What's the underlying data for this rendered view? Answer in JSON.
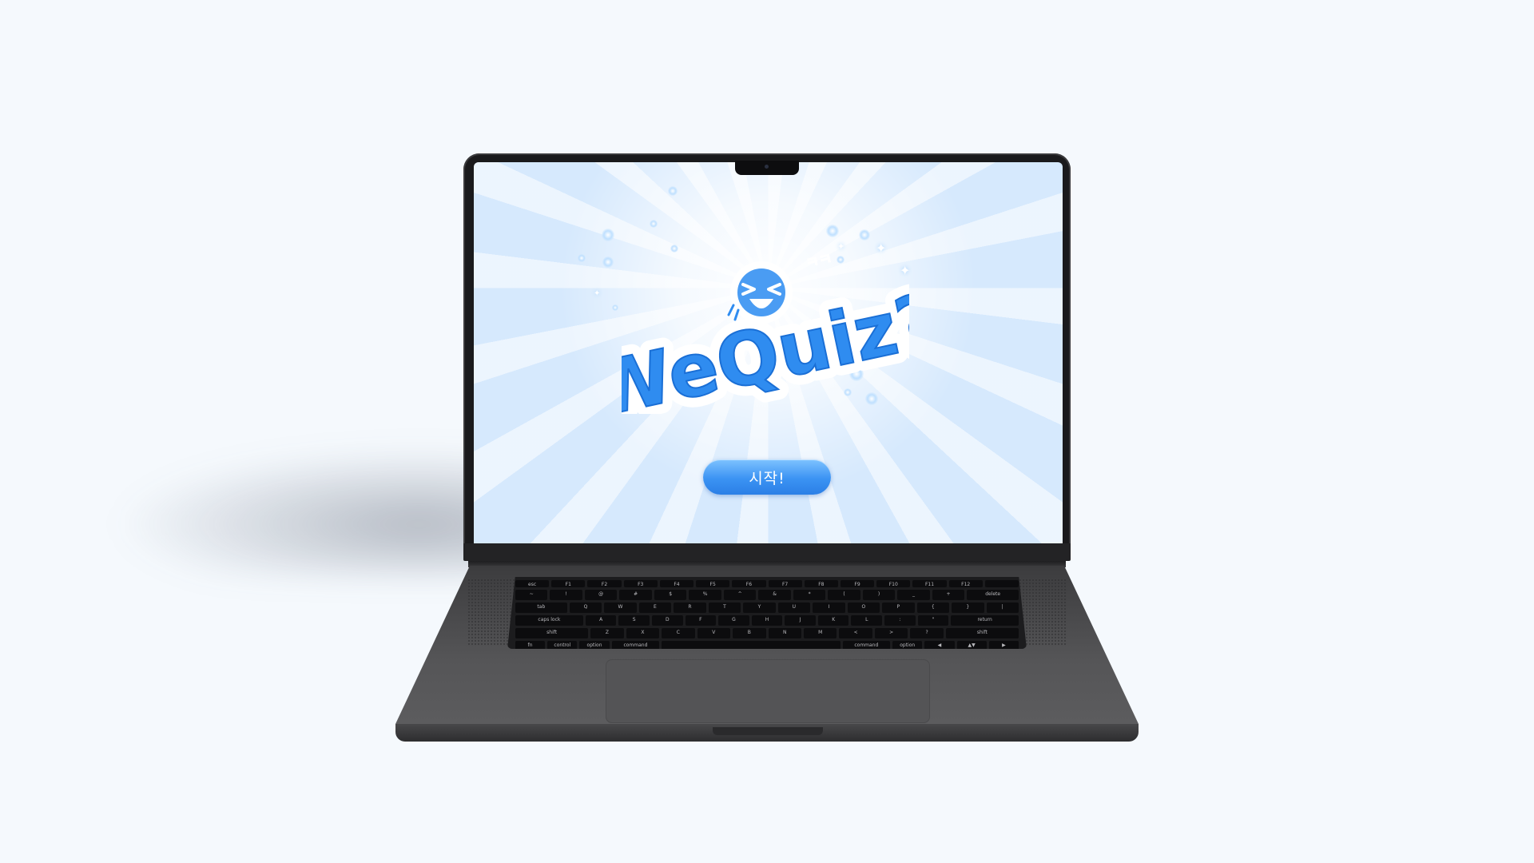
{
  "screen": {
    "logo_text": "WeQuiz?",
    "start_button_label": "시작!",
    "face_text": "ㅋㅋ"
  },
  "keyboard": {
    "fn_row": [
      "esc",
      "F1",
      "F2",
      "F3",
      "F4",
      "F5",
      "F6",
      "F7",
      "F8",
      "F9",
      "F10",
      "F11",
      "F12",
      ""
    ],
    "number_row": [
      "~",
      "!",
      "@",
      "#",
      "$",
      "%",
      "^",
      "&",
      "*",
      "(",
      ")",
      "_",
      "+",
      "delete"
    ],
    "top_row": [
      "tab",
      "Q",
      "W",
      "E",
      "R",
      "T",
      "Y",
      "U",
      "I",
      "O",
      "P",
      "{",
      "}",
      "|"
    ],
    "home_row": [
      "caps lock",
      "A",
      "S",
      "D",
      "F",
      "G",
      "H",
      "J",
      "K",
      "L",
      ":",
      "\"",
      "return"
    ],
    "bottom_row": [
      "shift",
      "Z",
      "X",
      "C",
      "V",
      "B",
      "N",
      "M",
      "<",
      ">",
      "?",
      "shift"
    ],
    "mod_row": [
      "fn",
      "control",
      "option",
      "command",
      "",
      "command",
      "option",
      "◀",
      "▲▼",
      "▶"
    ]
  },
  "colors": {
    "accent": "#2b7fe6",
    "screen_bg": "#d6e9fd",
    "logo_fill": "#2f8cf0"
  },
  "icons": [
    "notch-camera-icon",
    "sparkle-icon",
    "star-icon"
  ]
}
